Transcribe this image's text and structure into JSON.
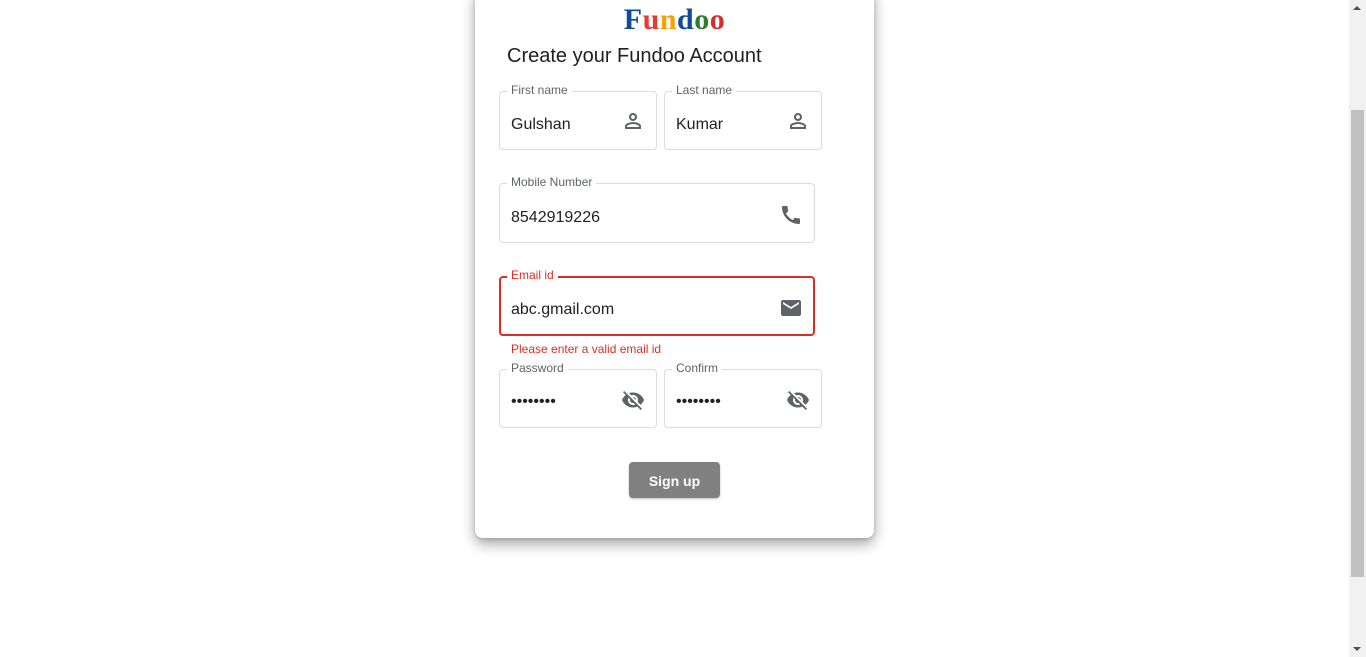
{
  "brand": {
    "letters": [
      {
        "ch": "F",
        "color": "#0f4c95"
      },
      {
        "ch": "u",
        "color": "#e53935"
      },
      {
        "ch": "n",
        "color": "#f4a400"
      },
      {
        "ch": "d",
        "color": "#0f4c95"
      },
      {
        "ch": "o",
        "color": "#2e7d32"
      },
      {
        "ch": "o",
        "color": "#d32f2f"
      }
    ]
  },
  "form": {
    "title": "Create your Fundoo Account",
    "first_name": {
      "label": "First name",
      "value": "Gulshan",
      "icon": "person-icon"
    },
    "last_name": {
      "label": "Last name",
      "value": "Kumar",
      "icon": "person-icon"
    },
    "mobile": {
      "label": "Mobile Number",
      "value": "8542919226",
      "icon": "phone-icon"
    },
    "email": {
      "label": "Email id",
      "value": "abc.gmail.com",
      "icon": "mail-icon",
      "error": "Please enter a valid email id"
    },
    "password": {
      "label": "Password",
      "value": "••••••••",
      "icon": "visibility-off-icon"
    },
    "confirm": {
      "label": "Confirm",
      "value": "••••••••",
      "icon": "visibility-off-icon"
    },
    "submit_label": "Sign up"
  },
  "colors": {
    "error": "#d93025",
    "button": "#808080",
    "border": "#dadce0"
  }
}
